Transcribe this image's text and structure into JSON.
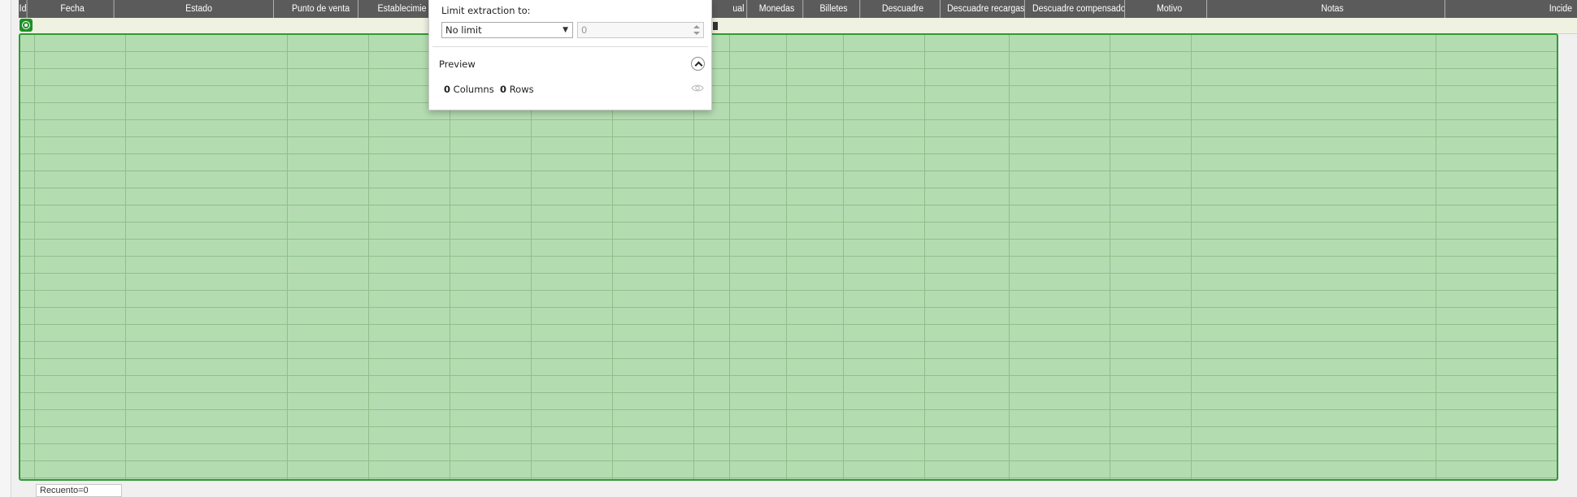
{
  "grid": {
    "columns": [
      {
        "key": "id",
        "label": "Id"
      },
      {
        "key": "fecha",
        "label": "Fecha"
      },
      {
        "key": "estado",
        "label": "Estado"
      },
      {
        "key": "punto_venta",
        "label": "Punto de venta"
      },
      {
        "key": "establecimiento",
        "label": "Establecimie"
      },
      {
        "key": "hidden1",
        "label": ""
      },
      {
        "key": "hidden2",
        "label": ""
      },
      {
        "key": "hidden3",
        "label": ""
      },
      {
        "key": "manual",
        "label": "ual"
      },
      {
        "key": "monedas",
        "label": "Monedas"
      },
      {
        "key": "billetes",
        "label": "Billetes"
      },
      {
        "key": "descuadre",
        "label": "Descuadre"
      },
      {
        "key": "descuadre_recargas",
        "label": "Descuadre recargas"
      },
      {
        "key": "descuadre_compensado",
        "label": "Descuadre compensado"
      },
      {
        "key": "motivo",
        "label": "Motivo"
      },
      {
        "key": "notas",
        "label": "Notas"
      },
      {
        "key": "incidencias",
        "label": "Incide"
      }
    ],
    "row_count": 0
  },
  "status": {
    "count_label": "Recuento=0"
  },
  "popup": {
    "limit_label": "Limit extraction to:",
    "limit_select_value": "No limit",
    "limit_number_value": "0",
    "preview_title": "Preview",
    "columns_count": "0",
    "columns_word": "Columns",
    "rows_count": "0",
    "rows_word": "Rows"
  },
  "colors": {
    "header_bg": "#5b5b5b",
    "grid_fill": "#b4dcb1",
    "grid_border": "#2f9a34",
    "filter_row_bg": "#eff2e1"
  }
}
